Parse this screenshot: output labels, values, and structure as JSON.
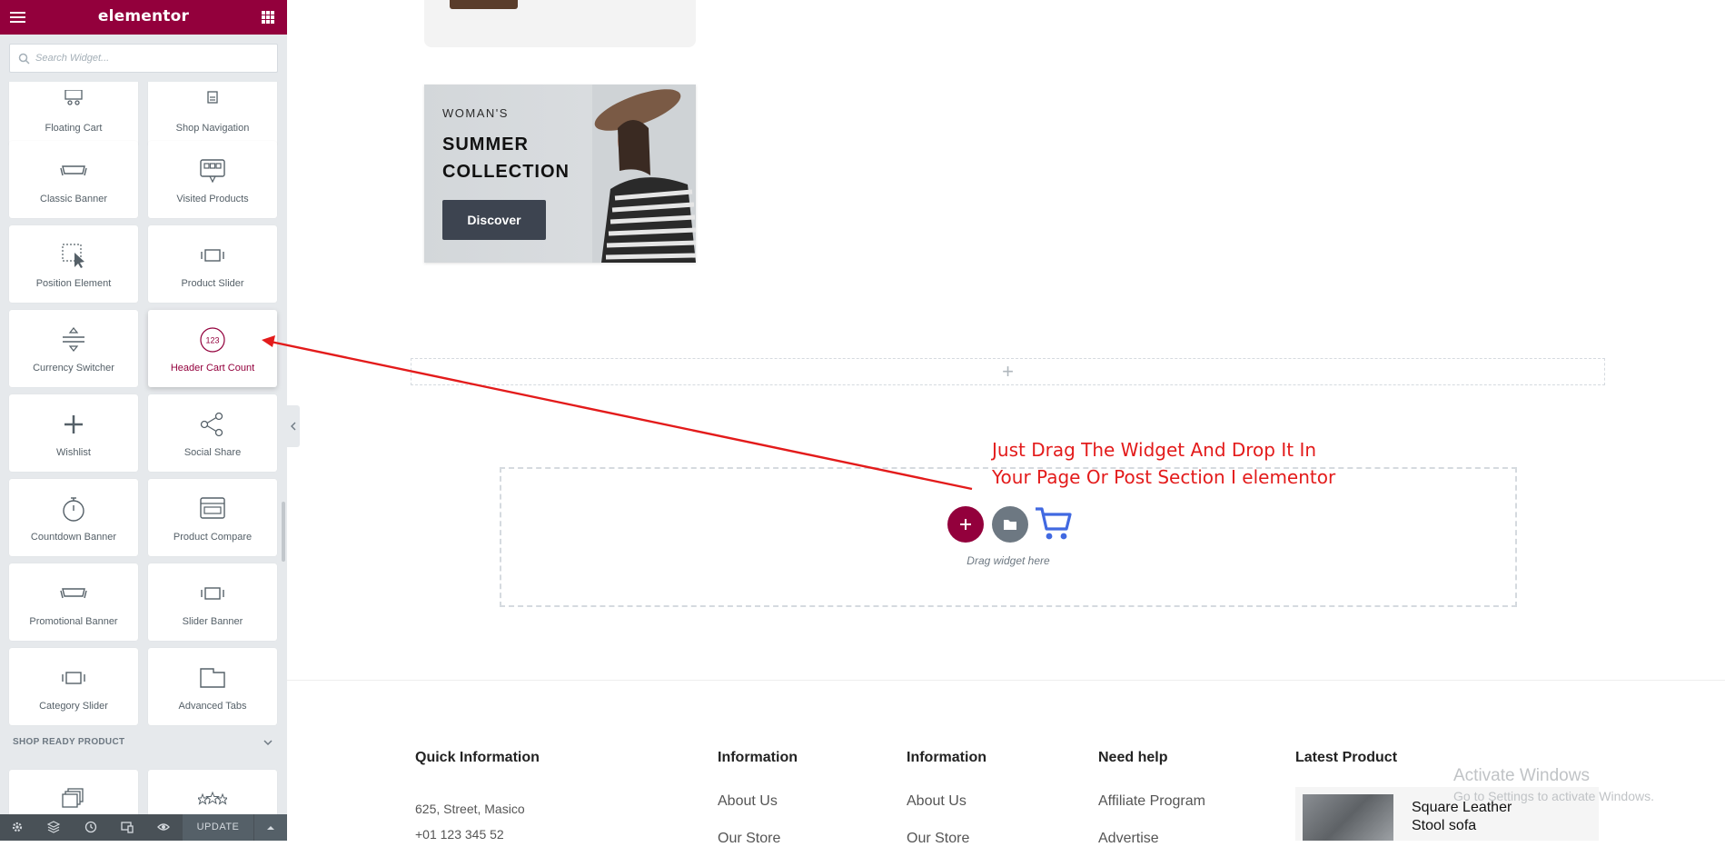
{
  "panel": {
    "logo": "elementor",
    "search_placeholder": "Search Widget...",
    "widgets": [
      {
        "label": "Floating Cart",
        "icon": "floating-cart-icon"
      },
      {
        "label": "Shop Navigation",
        "icon": "shop-navigation-icon"
      },
      {
        "label": "Classic Banner",
        "icon": "classic-banner-icon"
      },
      {
        "label": "Visited Products",
        "icon": "visited-products-icon"
      },
      {
        "label": "Position Element",
        "icon": "position-element-icon"
      },
      {
        "label": "Product Slider",
        "icon": "product-slider-icon"
      },
      {
        "label": "Currency Switcher",
        "icon": "currency-switcher-icon"
      },
      {
        "label": "Header Cart Count",
        "icon": "header-cart-count-icon"
      },
      {
        "label": "Wishlist",
        "icon": "plus-icon"
      },
      {
        "label": "Social Share",
        "icon": "share-icon"
      },
      {
        "label": "Countdown Banner",
        "icon": "stopwatch-icon"
      },
      {
        "label": "Product Compare",
        "icon": "product-compare-icon"
      },
      {
        "label": "Promotional Banner",
        "icon": "promotional-banner-icon"
      },
      {
        "label": "Slider Banner",
        "icon": "slider-banner-icon"
      },
      {
        "label": "Category Slider",
        "icon": "category-slider-icon"
      },
      {
        "label": "Advanced Tabs",
        "icon": "advanced-tabs-icon"
      }
    ],
    "header_cart_count_badge": "123",
    "category_title": "SHOP READY PRODUCT",
    "update_label": "UPDATE",
    "accent_color": "#93003c"
  },
  "canvas": {
    "banner": {
      "eyebrow": "WOMAN'S",
      "title_line_1": "SUMMER",
      "title_line_2": "COLLECTION",
      "button_label": "Discover"
    },
    "drop_zone": {
      "label": "Drag widget here"
    },
    "annotation": {
      "line_1": "Just Drag The Widget And Drop It In",
      "line_2": "Your Page Or Post Section I elementor",
      "color": "#e31b1b"
    },
    "footer": {
      "quick_info_title": "Quick Information",
      "address": "625, Street, Masico",
      "phone": "+01 123 345 52",
      "info_1_title": "Information",
      "info_1_link_1": "About Us",
      "info_1_link_2": "Our Store",
      "info_2_title": "Information",
      "info_2_link_1": "About Us",
      "info_2_link_2": "Our Store",
      "help_title": "Need help",
      "help_link_1": "Affiliate Program",
      "help_link_2": "Advertise",
      "latest_title": "Latest Product",
      "product_name_line_1": "Square Leather",
      "product_name_line_2": "Stool sofa"
    }
  },
  "windows_watermark": {
    "title": "Activate Windows",
    "subtitle": "Go to Settings to activate Windows."
  }
}
